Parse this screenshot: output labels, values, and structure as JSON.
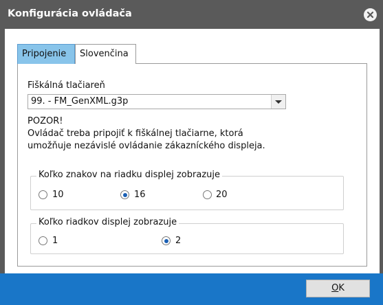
{
  "window": {
    "title": "Konfigurácia ovládača",
    "close_icon": "close-icon"
  },
  "tabs": [
    {
      "label": "Pripojenie",
      "active": true
    },
    {
      "label": "Slovenčina",
      "active": false
    }
  ],
  "printer": {
    "label": "Fiškálná tlačiareň",
    "selected": "99. - FM_GenXML.g3p"
  },
  "warning": {
    "title": "POZOR!",
    "line1": "Ovládač treba pripojiť k fiškálnej tlačiarne, ktorá",
    "line2": "umožňuje nezávislé ovládanie zákazníckého displeja."
  },
  "chars_group": {
    "legend": "Koľko znakov na riadku displej zobrazuje",
    "options": [
      {
        "label": "10",
        "checked": false
      },
      {
        "label": "16",
        "checked": true
      },
      {
        "label": "20",
        "checked": false
      }
    ]
  },
  "rows_group": {
    "legend": "Koľko riadkov displej zobrazuje",
    "options": [
      {
        "label": "1",
        "checked": false
      },
      {
        "label": "2",
        "checked": true
      }
    ]
  },
  "footer": {
    "ok_prefix": "",
    "ok_underlined": "O",
    "ok_rest": "K"
  }
}
